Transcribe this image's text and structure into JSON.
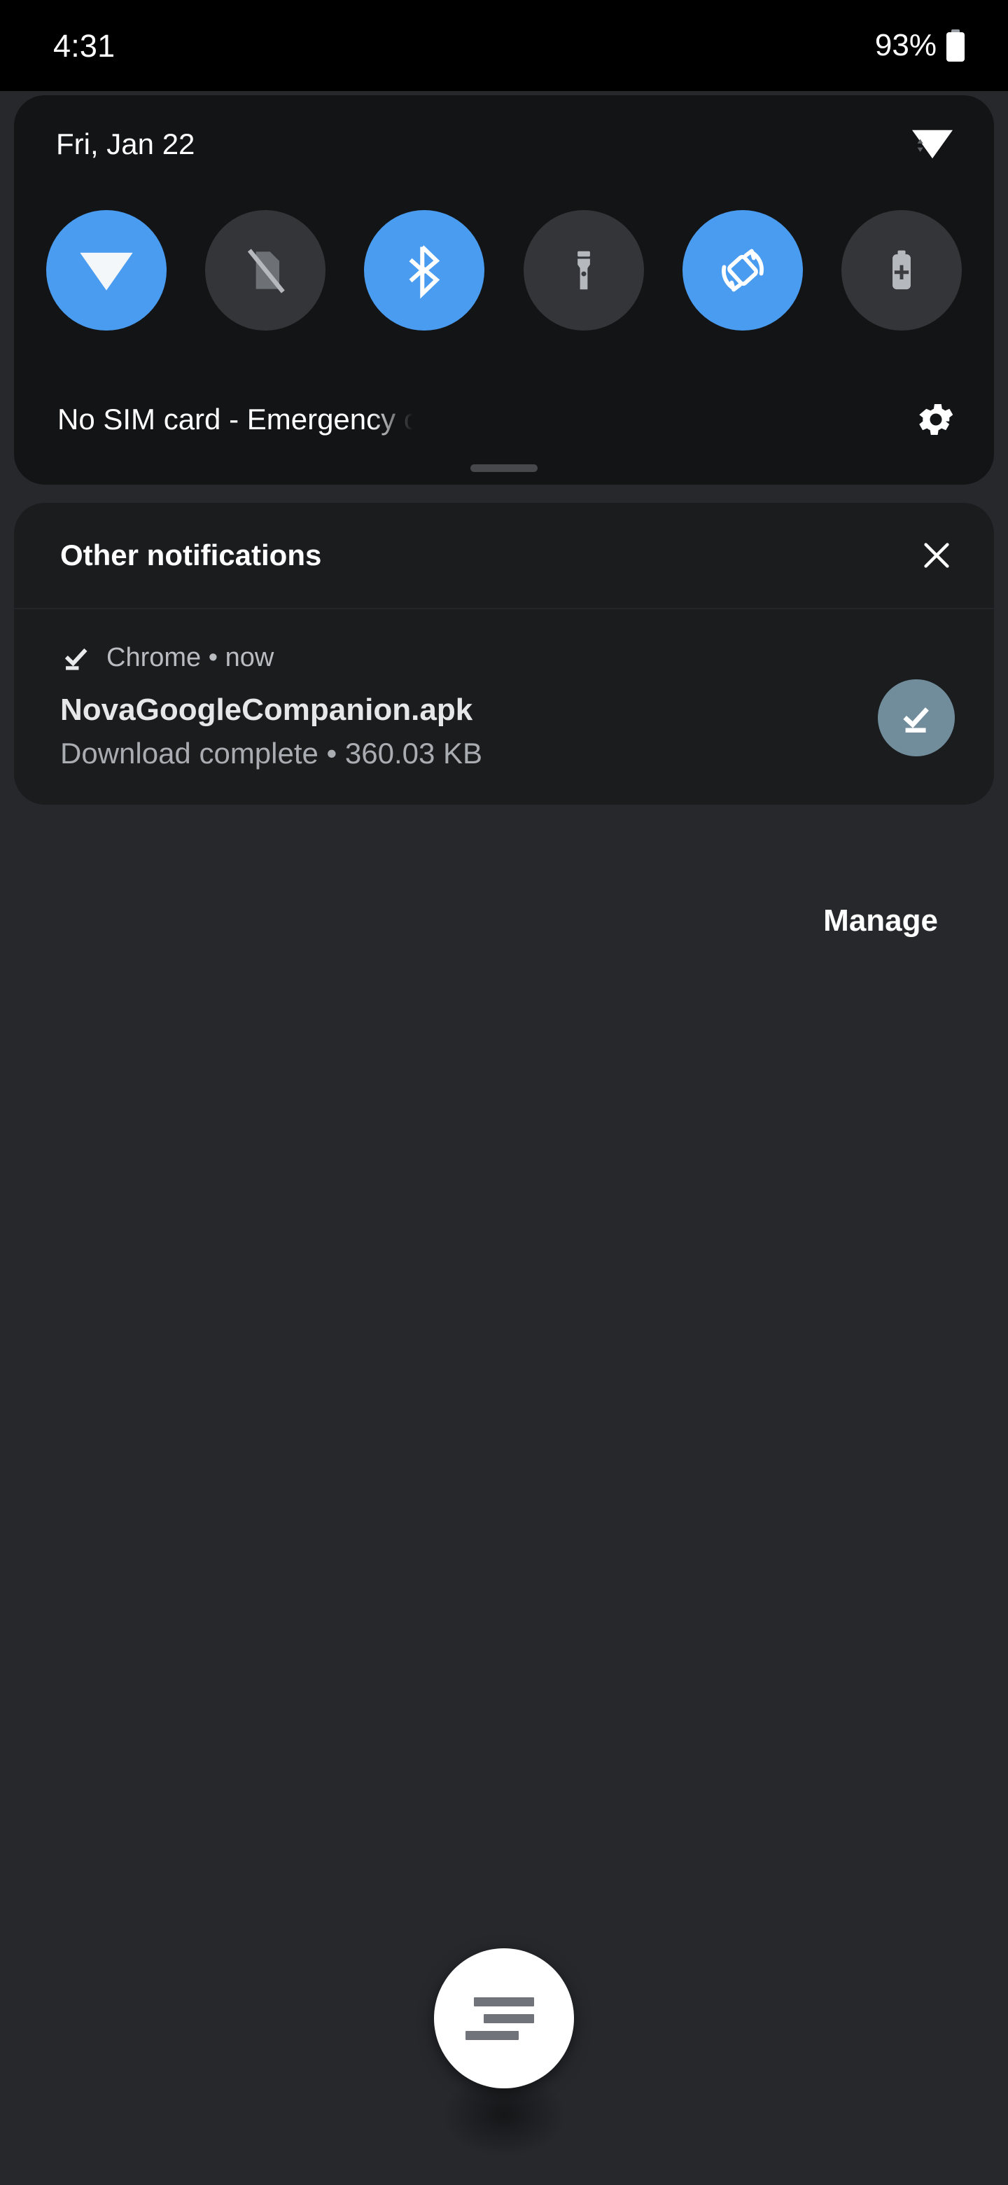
{
  "status_bar": {
    "clock": "4:31",
    "battery_percent": "93%",
    "battery_icon": "battery-full-icon"
  },
  "quick_settings": {
    "date": "Fri, Jan 22",
    "wifi_status_icon": "wifi-signal-icon",
    "settings_icon": "gear-icon",
    "drag_handle_label": "drag-handle",
    "carrier_text": "No SIM card - Emergency c",
    "tiles": [
      {
        "name": "wifi",
        "icon": "wifi-icon",
        "state": "on",
        "label": "Wi-Fi"
      },
      {
        "name": "mobile-data",
        "icon": "sim-off-icon",
        "state": "off",
        "label": "Mobile data"
      },
      {
        "name": "bluetooth",
        "icon": "bluetooth-icon",
        "state": "on",
        "label": "Bluetooth"
      },
      {
        "name": "flashlight",
        "icon": "flashlight-icon",
        "state": "off",
        "label": "Flashlight"
      },
      {
        "name": "auto-rotate",
        "icon": "auto-rotate-icon",
        "state": "on",
        "label": "Auto-rotate"
      },
      {
        "name": "battery-saver",
        "icon": "battery-saver-icon",
        "state": "off",
        "label": "Battery Saver"
      }
    ]
  },
  "notifications": {
    "section_title": "Other notifications",
    "close_icon": "close-icon",
    "items": [
      {
        "app_line": "Chrome • now",
        "small_icon": "download-done-icon",
        "title": "NovaGoogleCompanion.apk",
        "subtitle": "Download complete • 360.03 KB",
        "avatar_icon": "download-done-icon",
        "avatar_color": "#718d9c"
      }
    ],
    "manage_label": "Manage"
  },
  "fab": {
    "icon": "menu-lines-icon"
  },
  "colors": {
    "accent_blue": "#4a9cf0",
    "panel_bg": "#131416",
    "notification_bg": "#1a1c1e",
    "scrim_bg": "#26282c",
    "tile_off_bg": "#333538"
  }
}
